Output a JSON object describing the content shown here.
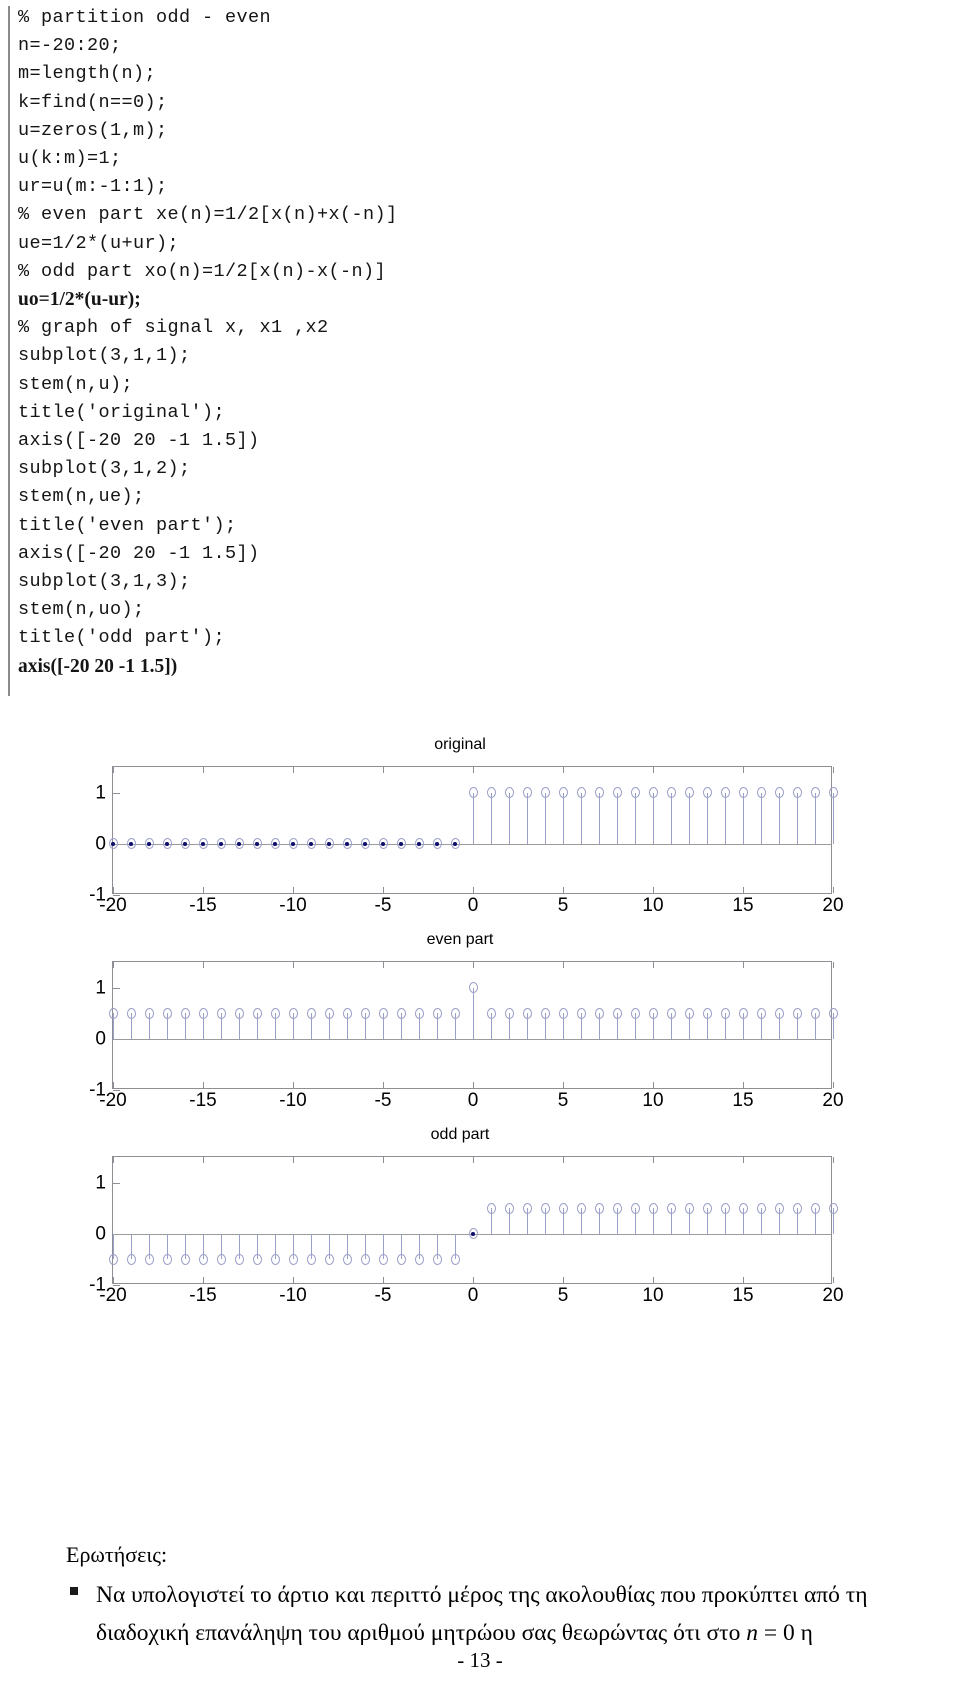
{
  "code": {
    "lines": [
      {
        "text": "% partition odd - even",
        "serif": false
      },
      {
        "text": "n=-20:20;",
        "serif": false
      },
      {
        "text": "m=length(n);",
        "serif": false
      },
      {
        "text": "k=find(n==0);",
        "serif": false
      },
      {
        "text": "u=zeros(1,m);",
        "serif": false
      },
      {
        "text": "u(k:m)=1;",
        "serif": false
      },
      {
        "text": "ur=u(m:-1:1);",
        "serif": false
      },
      {
        "text": "% even part xe(n)=1/2[x(n)+x(-n)]",
        "serif": false
      },
      {
        "text": "ue=1/2*(u+ur);",
        "serif": false
      },
      {
        "text": "% odd part xo(n)=1/2[x(n)-x(-n)]",
        "serif": false
      },
      {
        "text": "uo=1/2*(u-ur);",
        "serif": true
      },
      {
        "text": "% graph of signal x, x1 ,x2",
        "serif": false
      },
      {
        "text": "subplot(3,1,1);",
        "serif": false
      },
      {
        "text": "stem(n,u);",
        "serif": false
      },
      {
        "text": "title('original');",
        "serif": false
      },
      {
        "text": "axis([-20 20 -1 1.5])",
        "serif": false
      },
      {
        "text": "subplot(3,1,2);",
        "serif": false
      },
      {
        "text": "stem(n,ue);",
        "serif": false
      },
      {
        "text": "title('even part');",
        "serif": false
      },
      {
        "text": "axis([-20 20 -1 1.5])",
        "serif": false
      },
      {
        "text": "subplot(3,1,3);",
        "serif": false
      },
      {
        "text": "stem(n,uo);",
        "serif": false
      },
      {
        "text": "title('odd part');",
        "serif": false
      },
      {
        "text": "axis([-20 20 -1 1.5])",
        "serif": true
      }
    ]
  },
  "chart_data": [
    {
      "type": "stem",
      "title": "original",
      "xlabel": "",
      "ylabel": "",
      "xlim": [
        -20,
        20
      ],
      "ylim": [
        -1,
        1.5
      ],
      "xticks": [
        -20,
        -15,
        -10,
        -5,
        0,
        5,
        10,
        15,
        20
      ],
      "xtick_labels": [
        "-20",
        "-15",
        "-10",
        "-5",
        "0",
        "5",
        "10",
        "15",
        "20"
      ],
      "yticks": [
        -1,
        0,
        1
      ],
      "ytick_labels": [
        "-1",
        "0",
        "1"
      ],
      "grid": false,
      "legend": null,
      "marker_color": "#9aa0c8",
      "stem_color": "#9aa0c8",
      "x": [
        -20,
        -19,
        -18,
        -17,
        -16,
        -15,
        -14,
        -13,
        -12,
        -11,
        -10,
        -9,
        -8,
        -7,
        -6,
        -5,
        -4,
        -3,
        -2,
        -1,
        0,
        1,
        2,
        3,
        4,
        5,
        6,
        7,
        8,
        9,
        10,
        11,
        12,
        13,
        14,
        15,
        16,
        17,
        18,
        19,
        20
      ],
      "values": [
        0,
        0,
        0,
        0,
        0,
        0,
        0,
        0,
        0,
        0,
        0,
        0,
        0,
        0,
        0,
        0,
        0,
        0,
        0,
        0,
        1,
        1,
        1,
        1,
        1,
        1,
        1,
        1,
        1,
        1,
        1,
        1,
        1,
        1,
        1,
        1,
        1,
        1,
        1,
        1,
        1
      ]
    },
    {
      "type": "stem",
      "title": "even part",
      "xlabel": "",
      "ylabel": "",
      "xlim": [
        -20,
        20
      ],
      "ylim": [
        -1,
        1.5
      ],
      "xticks": [
        -20,
        -15,
        -10,
        -5,
        0,
        5,
        10,
        15,
        20
      ],
      "xtick_labels": [
        "-20",
        "-15",
        "-10",
        "-5",
        "0",
        "5",
        "10",
        "15",
        "20"
      ],
      "yticks": [
        -1,
        0,
        1
      ],
      "ytick_labels": [
        "-1",
        "0",
        "1"
      ],
      "grid": false,
      "legend": null,
      "marker_color": "#9aa0c8",
      "stem_color": "#9aa0c8",
      "x": [
        -20,
        -19,
        -18,
        -17,
        -16,
        -15,
        -14,
        -13,
        -12,
        -11,
        -10,
        -9,
        -8,
        -7,
        -6,
        -5,
        -4,
        -3,
        -2,
        -1,
        0,
        1,
        2,
        3,
        4,
        5,
        6,
        7,
        8,
        9,
        10,
        11,
        12,
        13,
        14,
        15,
        16,
        17,
        18,
        19,
        20
      ],
      "values": [
        0.5,
        0.5,
        0.5,
        0.5,
        0.5,
        0.5,
        0.5,
        0.5,
        0.5,
        0.5,
        0.5,
        0.5,
        0.5,
        0.5,
        0.5,
        0.5,
        0.5,
        0.5,
        0.5,
        0.5,
        1,
        0.5,
        0.5,
        0.5,
        0.5,
        0.5,
        0.5,
        0.5,
        0.5,
        0.5,
        0.5,
        0.5,
        0.5,
        0.5,
        0.5,
        0.5,
        0.5,
        0.5,
        0.5,
        0.5,
        0.5
      ]
    },
    {
      "type": "stem",
      "title": "odd part",
      "xlabel": "",
      "ylabel": "",
      "xlim": [
        -20,
        20
      ],
      "ylim": [
        -1,
        1.5
      ],
      "xticks": [
        -20,
        -15,
        -10,
        -5,
        0,
        5,
        10,
        15,
        20
      ],
      "xtick_labels": [
        "-20",
        "-15",
        "-10",
        "-5",
        "0",
        "5",
        "10",
        "15",
        "20"
      ],
      "yticks": [
        -1,
        0,
        1
      ],
      "ytick_labels": [
        "-1",
        "0",
        "1"
      ],
      "grid": false,
      "legend": null,
      "marker_color": "#9aa0c8",
      "stem_color": "#9aa0c8",
      "x": [
        -20,
        -19,
        -18,
        -17,
        -16,
        -15,
        -14,
        -13,
        -12,
        -11,
        -10,
        -9,
        -8,
        -7,
        -6,
        -5,
        -4,
        -3,
        -2,
        -1,
        0,
        1,
        2,
        3,
        4,
        5,
        6,
        7,
        8,
        9,
        10,
        11,
        12,
        13,
        14,
        15,
        16,
        17,
        18,
        19,
        20
      ],
      "values": [
        -0.5,
        -0.5,
        -0.5,
        -0.5,
        -0.5,
        -0.5,
        -0.5,
        -0.5,
        -0.5,
        -0.5,
        -0.5,
        -0.5,
        -0.5,
        -0.5,
        -0.5,
        -0.5,
        -0.5,
        -0.5,
        -0.5,
        -0.5,
        0,
        0.5,
        0.5,
        0.5,
        0.5,
        0.5,
        0.5,
        0.5,
        0.5,
        0.5,
        0.5,
        0.5,
        0.5,
        0.5,
        0.5,
        0.5,
        0.5,
        0.5,
        0.5,
        0.5,
        0.5
      ]
    }
  ],
  "questions": {
    "heading": "Ερωτήσεις:",
    "item_part1": "Να υπολογιστεί το άρτιο και περιττό μέρος της ακολουθίας που προκύπτει από τη διαδοχική επανάληψη του αριθμού μητρώου σας θεωρώντας ότι στο ",
    "item_var": "n",
    "item_eq": " = 0 ",
    "item_part2": "η"
  },
  "page_number": "- 13 -"
}
